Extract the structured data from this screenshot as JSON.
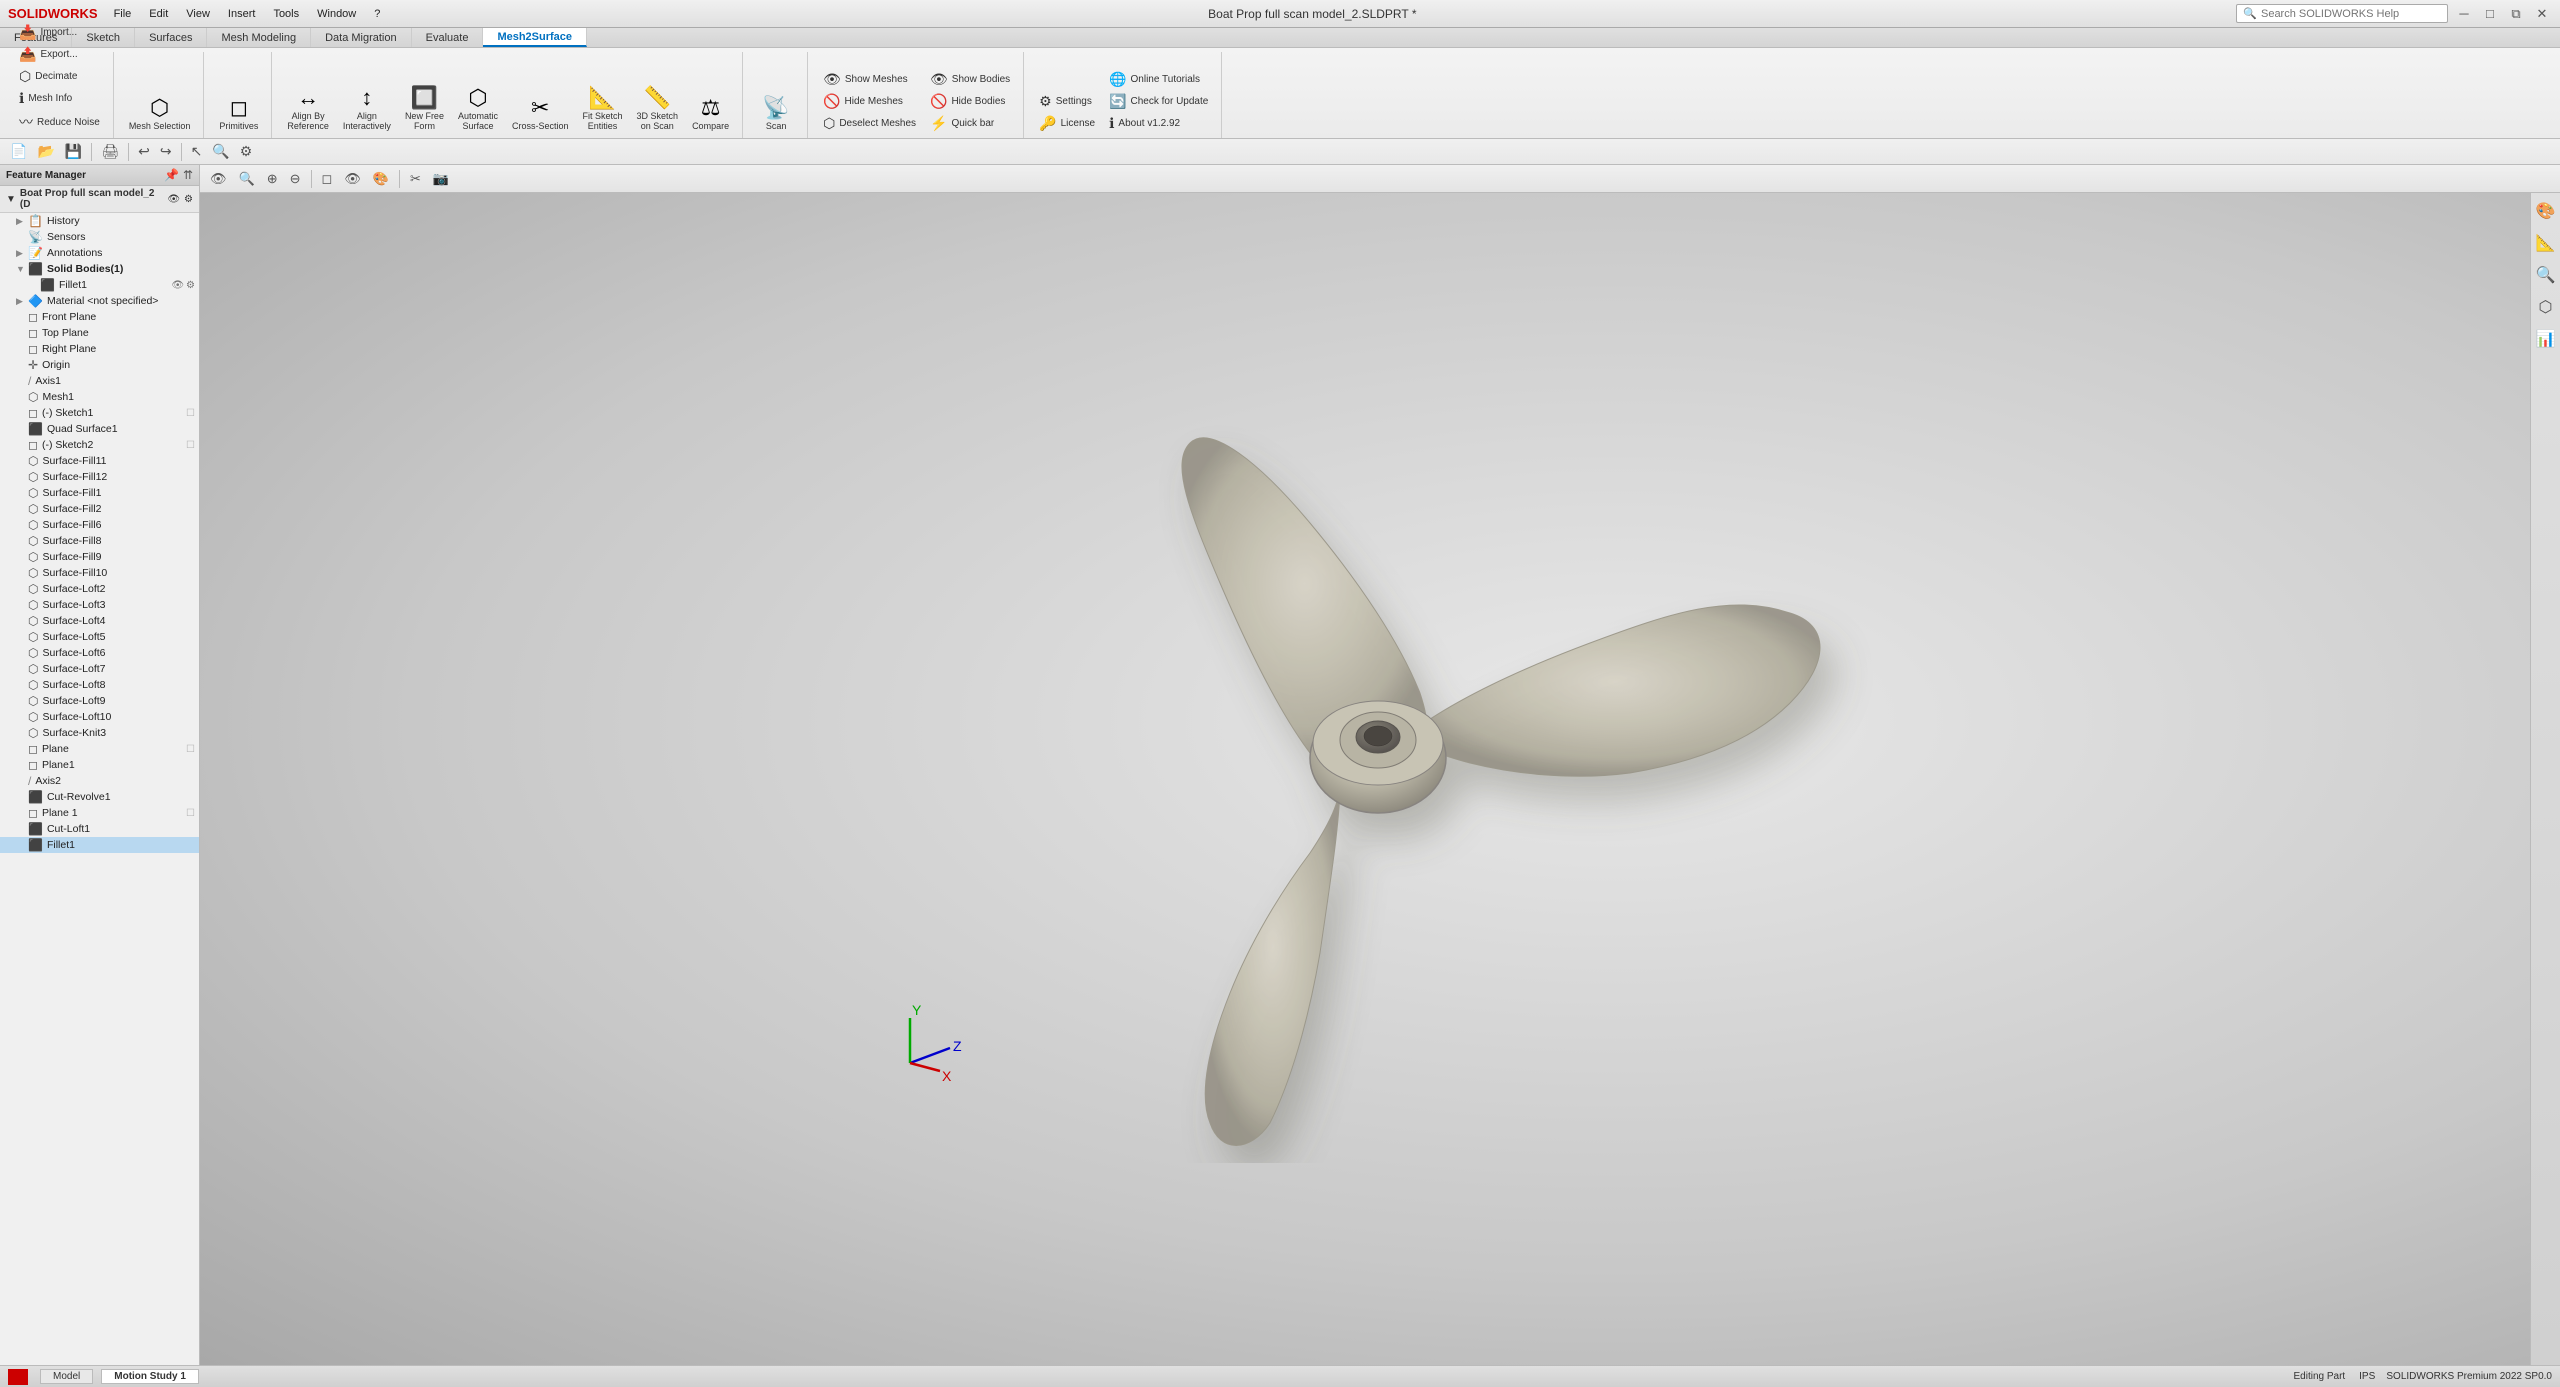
{
  "window": {
    "title": "Boat Prop full scan model_2.SLDPRT *",
    "logo": "SOLIDWORKS",
    "status": "Editing Part",
    "version": "SOLIDWORKS Premium 2022 SP0.0"
  },
  "menu": {
    "items": [
      "File",
      "Edit",
      "View",
      "Insert",
      "Tools",
      "Window",
      "?"
    ]
  },
  "search": {
    "placeholder": "Search SOLIDWORKS Help"
  },
  "ribbon": {
    "tabs": [
      "Features",
      "Sketch",
      "Surfaces",
      "Mesh Modeling",
      "Data Migration",
      "Evaluate",
      "Mesh2Surface"
    ],
    "active_tab": "Mesh2Surface",
    "groups": {
      "import_export": {
        "import": "Import...",
        "export": "Export...",
        "decimate": "Decimate",
        "mesh_info": "Mesh Info",
        "reduce_noise": "Reduce Noise"
      },
      "mesh_selection": {
        "label": "Mesh Selection",
        "icon": "⬡"
      },
      "primitives": {
        "label": "Primitives",
        "icon": "◻"
      },
      "fit_surface": {
        "new_free_form": "New Free\nForm",
        "automatic_surface": "Automatic\nSurface",
        "align_by_reference": "Align By\nReference",
        "align_interactively": "Align\nInteractively",
        "fit_sketch_entities": "Fit Sketch\nEntities",
        "3d_sketch_on_scan": "3D Sketch\non Scan",
        "cross_section": "Cross-Section",
        "compare": "Compare"
      },
      "show_hide": {
        "show_meshes": "Show Meshes",
        "show_bodies": "Show Bodies",
        "hide_meshes": "Hide Meshes",
        "hide_bodies": "Hide Bodies",
        "deselect_meshes": "Deselect Meshes",
        "quick_bar": "Quick bar"
      },
      "settings": {
        "settings": "Settings",
        "license": "License",
        "online_tutorials": "Online Tutorials",
        "check_for_update": "Check for Update",
        "about": "About v1.2.92"
      }
    }
  },
  "command_toolbar": {
    "buttons": [
      "⬜",
      "📄",
      "💾",
      "🖨",
      "↩",
      "↪",
      "✂",
      "📋",
      "🔍",
      "⚙"
    ]
  },
  "tree": {
    "root_label": "Boat Prop full scan model_2 (D",
    "items": [
      {
        "label": "History",
        "icon": "📋",
        "indent": 1,
        "expand": "▶"
      },
      {
        "label": "Sensors",
        "icon": "📡",
        "indent": 1,
        "expand": ""
      },
      {
        "label": "Annotations",
        "icon": "📝",
        "indent": 1,
        "expand": "▶"
      },
      {
        "label": "Solid Bodies(1)",
        "icon": "⬛",
        "indent": 1,
        "expand": "▼",
        "bold": true
      },
      {
        "label": "Fillet1",
        "icon": "⬛",
        "indent": 2,
        "expand": "",
        "has_actions": true
      },
      {
        "label": "Material <not specified>",
        "icon": "🔷",
        "indent": 1,
        "expand": "▶"
      },
      {
        "label": "Front Plane",
        "icon": "◻",
        "indent": 1,
        "expand": ""
      },
      {
        "label": "Top Plane",
        "icon": "◻",
        "indent": 1,
        "expand": ""
      },
      {
        "label": "Right Plane",
        "icon": "◻",
        "indent": 1,
        "expand": ""
      },
      {
        "label": "Origin",
        "icon": "✛",
        "indent": 1,
        "expand": ""
      },
      {
        "label": "Axis1",
        "icon": "/",
        "indent": 1,
        "expand": ""
      },
      {
        "label": "Mesh1",
        "icon": "⬡",
        "indent": 1,
        "expand": ""
      },
      {
        "label": "(-) Sketch1",
        "icon": "◻",
        "indent": 1,
        "expand": ""
      },
      {
        "label": "Quad Surface1",
        "icon": "⬛",
        "indent": 1,
        "expand": ""
      },
      {
        "label": "(-) Sketch2",
        "icon": "◻",
        "indent": 1,
        "expand": ""
      },
      {
        "label": "Surface-Fill11",
        "icon": "⬡",
        "indent": 1,
        "expand": ""
      },
      {
        "label": "Surface-Fill12",
        "icon": "⬡",
        "indent": 1,
        "expand": ""
      },
      {
        "label": "Surface-Fill1",
        "icon": "⬡",
        "indent": 1,
        "expand": ""
      },
      {
        "label": "Surface-Fill2",
        "icon": "⬡",
        "indent": 1,
        "expand": ""
      },
      {
        "label": "Surface-Fill6",
        "icon": "⬡",
        "indent": 1,
        "expand": ""
      },
      {
        "label": "Surface-Fill8",
        "icon": "⬡",
        "indent": 1,
        "expand": ""
      },
      {
        "label": "Surface-Fill9",
        "icon": "⬡",
        "indent": 1,
        "expand": ""
      },
      {
        "label": "Surface-Fill10",
        "icon": "⬡",
        "indent": 1,
        "expand": ""
      },
      {
        "label": "Surface-Loft2",
        "icon": "⬡",
        "indent": 1,
        "expand": ""
      },
      {
        "label": "Surface-Loft3",
        "icon": "⬡",
        "indent": 1,
        "expand": ""
      },
      {
        "label": "Surface-Loft4",
        "icon": "⬡",
        "indent": 1,
        "expand": ""
      },
      {
        "label": "Surface-Loft5",
        "icon": "⬡",
        "indent": 1,
        "expand": ""
      },
      {
        "label": "Surface-Loft6",
        "icon": "⬡",
        "indent": 1,
        "expand": ""
      },
      {
        "label": "Surface-Loft7",
        "icon": "⬡",
        "indent": 1,
        "expand": ""
      },
      {
        "label": "Surface-Loft8",
        "icon": "⬡",
        "indent": 1,
        "expand": ""
      },
      {
        "label": "Surface-Loft9",
        "icon": "⬡",
        "indent": 1,
        "expand": ""
      },
      {
        "label": "Surface-Loft10",
        "icon": "⬡",
        "indent": 1,
        "expand": ""
      },
      {
        "label": "Surface-Knit3",
        "icon": "⬡",
        "indent": 1,
        "expand": ""
      },
      {
        "label": "Plane",
        "icon": "◻",
        "indent": 1,
        "expand": "",
        "has_actions": true
      },
      {
        "label": "Plane1",
        "icon": "◻",
        "indent": 1,
        "expand": ""
      },
      {
        "label": "Axis2",
        "icon": "/",
        "indent": 1,
        "expand": ""
      },
      {
        "label": "Cut-Revolve1",
        "icon": "⬛",
        "indent": 1,
        "expand": ""
      },
      {
        "label": "Plane 1",
        "icon": "◻",
        "indent": 1,
        "expand": "",
        "has_actions": true
      },
      {
        "label": "Cut-Loft1",
        "icon": "⬛",
        "indent": 1,
        "expand": ""
      },
      {
        "label": "Fillet1",
        "icon": "⬛",
        "indent": 1,
        "expand": "",
        "selected": true
      }
    ]
  },
  "viewport": {
    "background_start": "#e8e8e8",
    "background_end": "#a8a8a8"
  },
  "statusbar": {
    "tabs": [
      "Model",
      "Motion Study 1"
    ],
    "active_tab": "Model",
    "status": "Editing Part",
    "ips": "IPS"
  }
}
